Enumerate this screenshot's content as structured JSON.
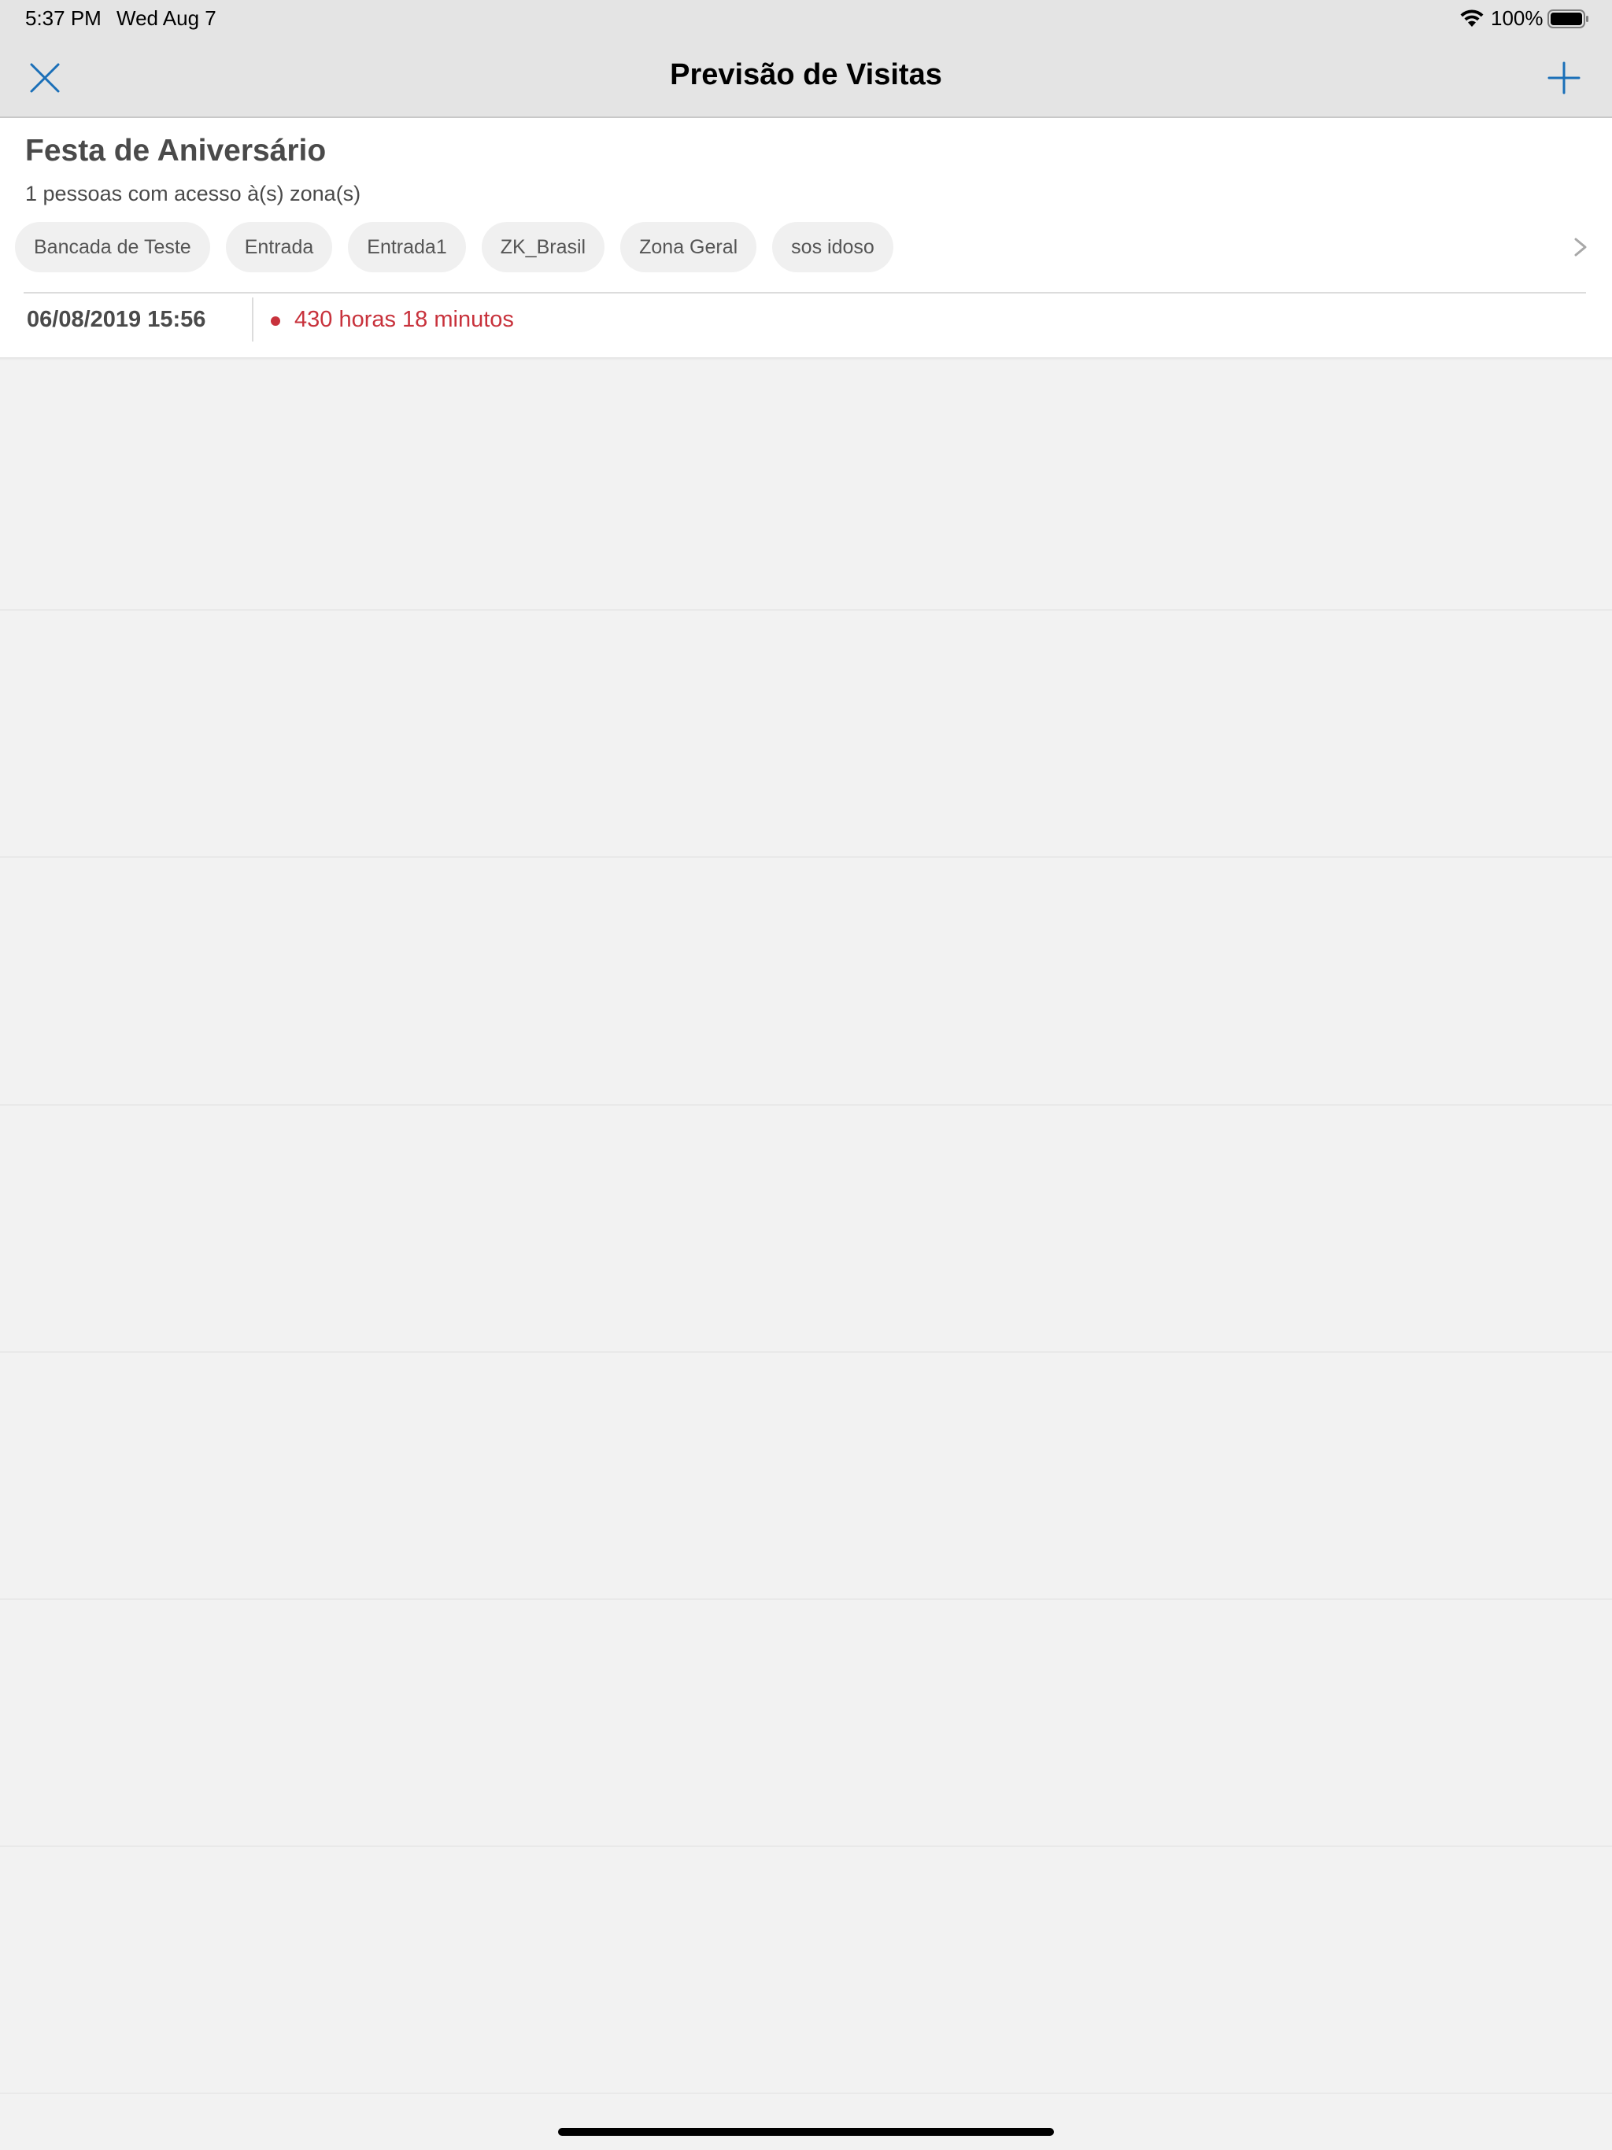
{
  "status_bar": {
    "time": "5:37 PM",
    "date": "Wed Aug 7",
    "battery_pct": "100%",
    "wifi_icon": "wifi-icon",
    "battery_icon": "battery-icon"
  },
  "nav": {
    "title": "Previsão de Visitas",
    "close_icon": "close-icon",
    "add_icon": "plus-icon",
    "accent_color": "#1a6fb8"
  },
  "visits": [
    {
      "title": "Festa de Aniversário",
      "subtitle": "1 pessoas com acesso à(s) zona(s)",
      "zones": [
        "Bancada de Teste",
        "Entrada",
        "Entrada1",
        "ZK_Brasil",
        "Zona Geral",
        "sos idoso"
      ],
      "datetime": "06/08/2019 15:56",
      "duration": "430 horas 18 minutos",
      "status_color": "#c8323c",
      "chevron_icon": "chevron-right-icon"
    }
  ]
}
